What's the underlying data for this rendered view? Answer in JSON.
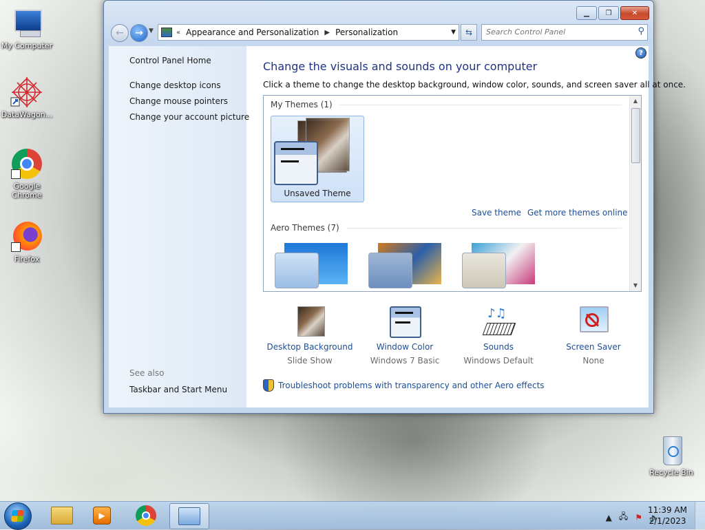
{
  "desktop": {
    "icons": [
      {
        "label": "My Computer",
        "icon": "computer-icon"
      },
      {
        "label": "DataWagon...",
        "icon": "datawagon-icon"
      },
      {
        "label": "Google Chrome",
        "icon": "chrome-icon"
      },
      {
        "label": "Firefox",
        "icon": "firefox-icon"
      },
      {
        "label": "Recycle Bin",
        "icon": "recycle-bin-icon"
      }
    ]
  },
  "window": {
    "breadcrumb": [
      "Appearance and Personalization",
      "Personalization"
    ],
    "breadcrumb_prefix": "«",
    "search_placeholder": "Search Control Panel",
    "sidebar": {
      "home": "Control Panel Home",
      "links": [
        "Change desktop icons",
        "Change mouse pointers",
        "Change your account picture"
      ],
      "see_also_label": "See also",
      "see_also_links": [
        "Taskbar and Start Menu"
      ]
    },
    "main": {
      "title": "Change the visuals and sounds on your computer",
      "description": "Click a theme to change the desktop background, window color, sounds, and screen saver all at once.",
      "my_themes_header": "My Themes (1)",
      "my_theme_name": "Unsaved Theme",
      "save_theme": "Save theme",
      "more_themes": "Get more themes online",
      "aero_themes_header": "Aero Themes (7)",
      "settings": [
        {
          "name": "Desktop Background",
          "value": "Slide Show"
        },
        {
          "name": "Window Color",
          "value": "Windows 7 Basic"
        },
        {
          "name": "Sounds",
          "value": "Windows Default"
        },
        {
          "name": "Screen Saver",
          "value": "None"
        }
      ],
      "troubleshoot": "Troubleshoot problems with transparency and other Aero effects"
    }
  },
  "taskbar": {
    "time": "11:39 AM",
    "date": "2/1/2023",
    "pinned": [
      "explorer-icon",
      "media-player-icon",
      "chrome-icon",
      "control-panel-icon"
    ]
  },
  "colors": {
    "link": "#1c4e94",
    "title": "#1e3287",
    "close_button": "#c54a2c"
  }
}
